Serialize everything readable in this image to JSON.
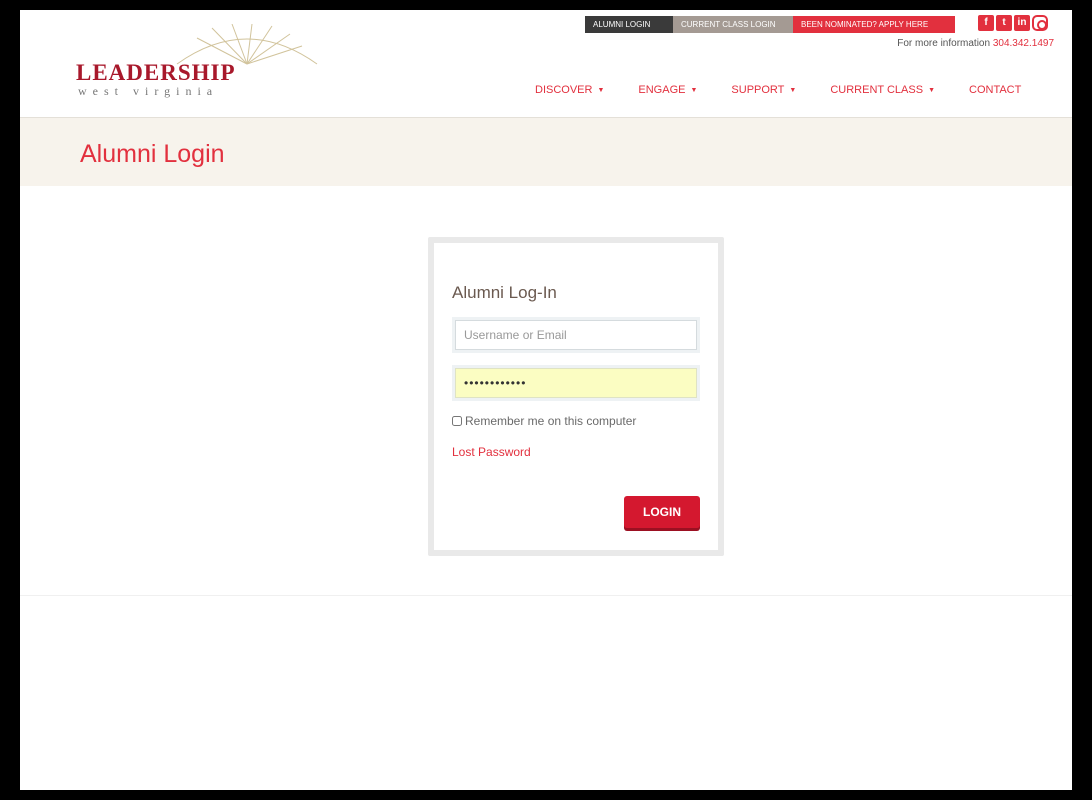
{
  "header": {
    "logo": {
      "word": "LEADERSHIP",
      "sub": "west virginia"
    },
    "topbar": {
      "alumni_login": "ALUMNI LOGIN",
      "current_class_login": "CURRENT CLASS LOGIN",
      "nominated": "BEEN NOMINATED? APPLY HERE"
    },
    "social": {
      "facebook": "f",
      "twitter": "t",
      "linkedin": "in",
      "instagram": "instagram-icon"
    },
    "info_label": "For more information",
    "phone": "304.342.1497",
    "nav": [
      {
        "label": "DISCOVER"
      },
      {
        "label": "ENGAGE"
      },
      {
        "label": "SUPPORT"
      },
      {
        "label": "CURRENT CLASS"
      },
      {
        "label": "CONTACT"
      }
    ]
  },
  "page": {
    "title": "Alumni Login"
  },
  "login": {
    "title": "Alumni Log-In",
    "username_placeholder": "Username or Email",
    "username_value": "",
    "password_value": "••••••••••••",
    "remember_label": "Remember me on this computer",
    "lost_password": "Lost Password",
    "button": "LOGIN"
  },
  "colors": {
    "accent": "#e2303e",
    "button": "#d4182f",
    "band": "#f7f3ec",
    "brand": "#a8182b"
  }
}
